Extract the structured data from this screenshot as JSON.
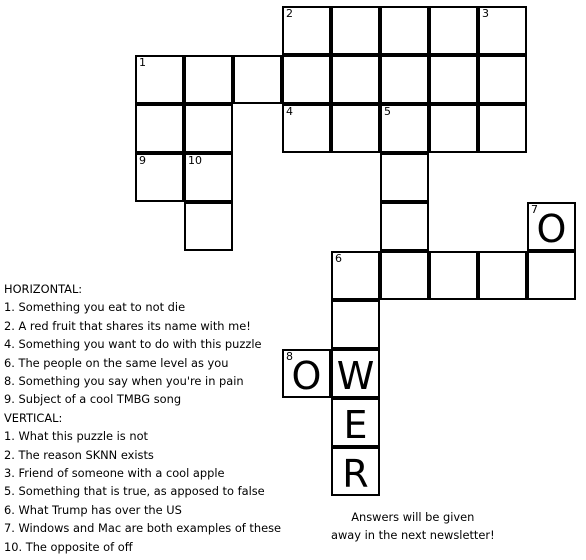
{
  "puzzle": {
    "cells": [
      {
        "col": 5,
        "row": 0,
        "number": "2",
        "letter": ""
      },
      {
        "col": 6,
        "row": 0,
        "number": "",
        "letter": ""
      },
      {
        "col": 7,
        "row": 0,
        "number": "",
        "letter": ""
      },
      {
        "col": 8,
        "row": 0,
        "number": "",
        "letter": ""
      },
      {
        "col": 9,
        "row": 0,
        "number": "3",
        "letter": ""
      },
      {
        "col": 2,
        "row": 1,
        "number": "1",
        "letter": ""
      },
      {
        "col": 3,
        "row": 1,
        "number": "",
        "letter": ""
      },
      {
        "col": 4,
        "row": 1,
        "number": "",
        "letter": ""
      },
      {
        "col": 5,
        "row": 1,
        "number": "",
        "letter": ""
      },
      {
        "col": 6,
        "row": 1,
        "number": "",
        "letter": ""
      },
      {
        "col": 7,
        "row": 1,
        "number": "",
        "letter": ""
      },
      {
        "col": 8,
        "row": 1,
        "number": "",
        "letter": ""
      },
      {
        "col": 9,
        "row": 1,
        "number": "",
        "letter": ""
      },
      {
        "col": 2,
        "row": 2,
        "number": "",
        "letter": ""
      },
      {
        "col": 3,
        "row": 2,
        "number": "",
        "letter": ""
      },
      {
        "col": 5,
        "row": 2,
        "number": "4",
        "letter": ""
      },
      {
        "col": 6,
        "row": 2,
        "number": "",
        "letter": ""
      },
      {
        "col": 7,
        "row": 2,
        "number": "5",
        "letter": ""
      },
      {
        "col": 8,
        "row": 2,
        "number": "",
        "letter": ""
      },
      {
        "col": 9,
        "row": 2,
        "number": "",
        "letter": ""
      },
      {
        "col": 2,
        "row": 3,
        "number": "9",
        "letter": ""
      },
      {
        "col": 3,
        "row": 3,
        "number": "10",
        "letter": ""
      },
      {
        "col": 7,
        "row": 3,
        "number": "",
        "letter": ""
      },
      {
        "col": 3,
        "row": 4,
        "number": "",
        "letter": ""
      },
      {
        "col": 7,
        "row": 4,
        "number": "",
        "letter": ""
      },
      {
        "col": 10,
        "row": 4,
        "number": "7",
        "letter": "O"
      },
      {
        "col": 6,
        "row": 5,
        "number": "6",
        "letter": ""
      },
      {
        "col": 7,
        "row": 5,
        "number": "",
        "letter": ""
      },
      {
        "col": 8,
        "row": 5,
        "number": "",
        "letter": ""
      },
      {
        "col": 9,
        "row": 5,
        "number": "",
        "letter": ""
      },
      {
        "col": 10,
        "row": 5,
        "number": "",
        "letter": ""
      },
      {
        "col": 6,
        "row": 6,
        "number": "",
        "letter": ""
      },
      {
        "col": 5,
        "row": 7,
        "number": "8",
        "letter": "O"
      },
      {
        "col": 6,
        "row": 7,
        "number": "",
        "letter": "W"
      },
      {
        "col": 6,
        "row": 8,
        "number": "",
        "letter": "E"
      },
      {
        "col": 6,
        "row": 9,
        "number": "",
        "letter": "R"
      }
    ]
  },
  "clues": {
    "horizontal_heading": "HORIZONTAL:",
    "horizontal": [
      "1. Something you eat to not die",
      "2. A red fruit that shares its name with me!",
      "4. Something you want to do with this puzzle",
      "6. The people on the same level as you",
      "8. Something you say when you're in pain",
      "9. Subject of a cool TMBG song"
    ],
    "vertical_heading": "VERTICAL:",
    "vertical": [
      "1. What this puzzle is not",
      "2. The reason SKNN exists",
      "3. Friend of someone with a cool apple",
      "5. Something that is true, as apposed to false",
      "6. What Trump has over the US",
      "7. Windows and Mac are both examples of these",
      "10. The opposite of off"
    ]
  },
  "footer": {
    "line1": "Answers will be given",
    "line2": "away in the next newsletter!"
  }
}
